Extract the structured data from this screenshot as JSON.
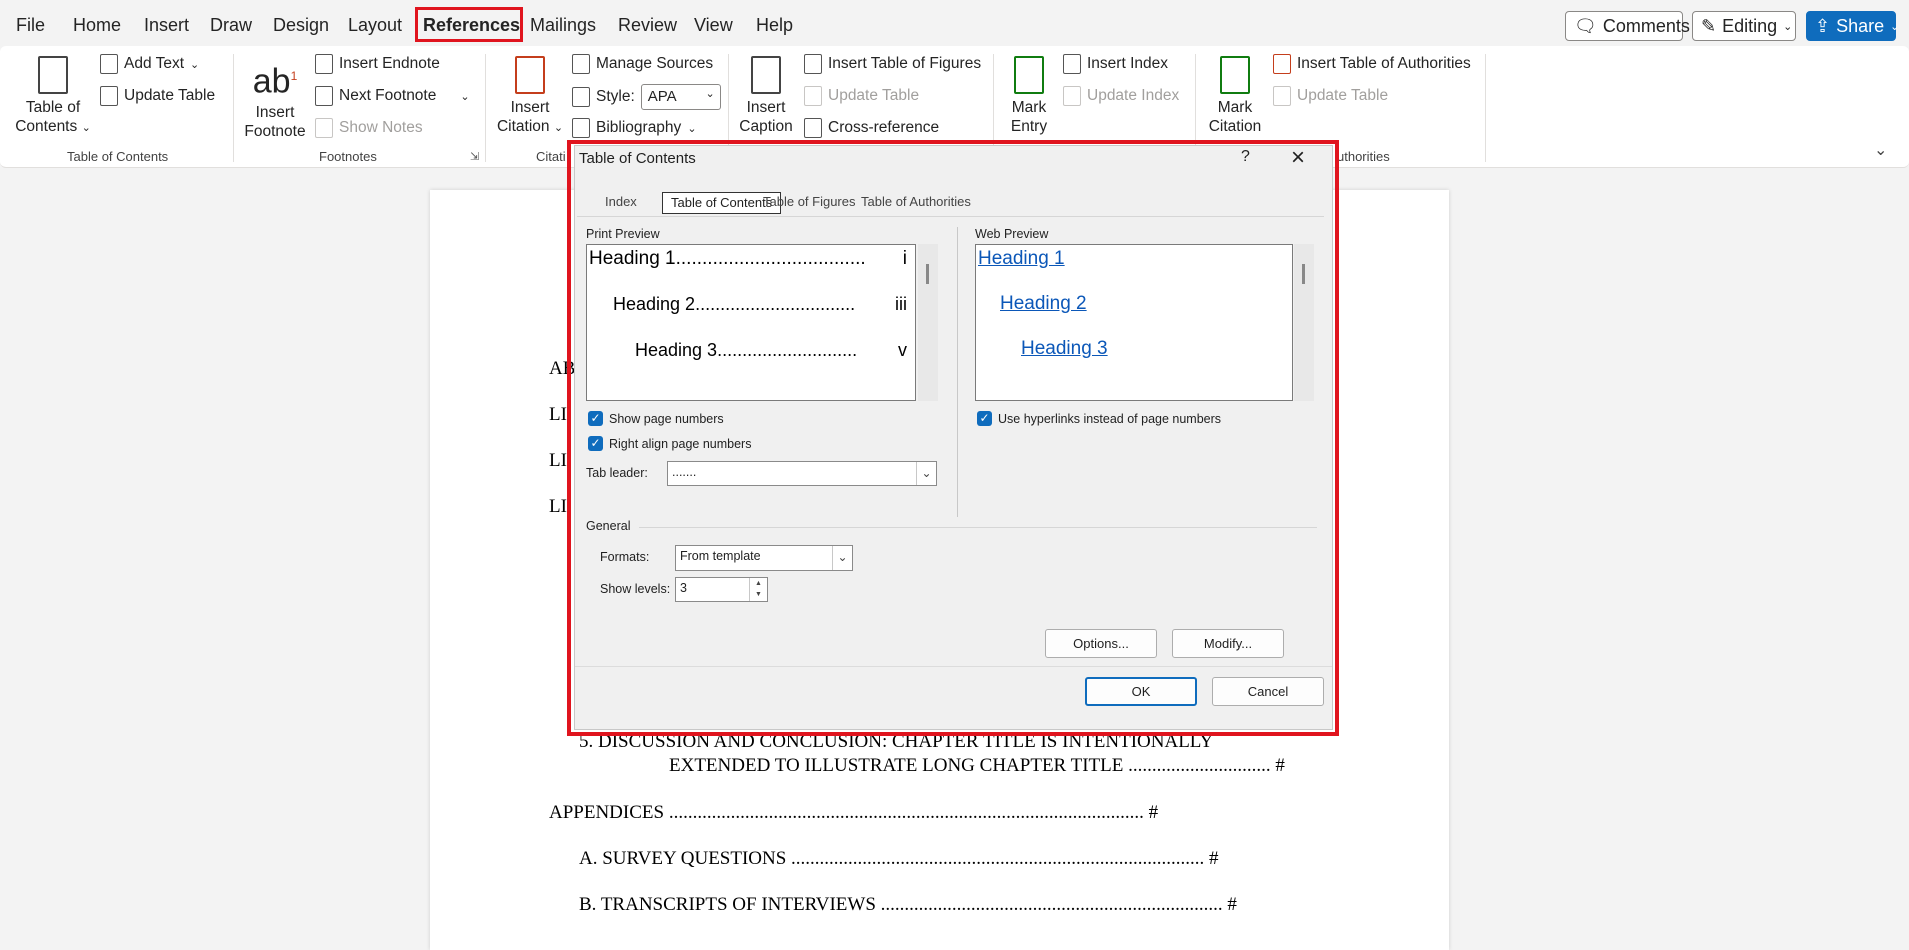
{
  "menu": {
    "tabs": [
      "File",
      "Home",
      "Insert",
      "Draw",
      "Design",
      "Layout",
      "References",
      "Mailings",
      "Review",
      "View",
      "Help"
    ],
    "active_tab": "References"
  },
  "header": {
    "comments": "Comments",
    "editing": "Editing",
    "share": "Share"
  },
  "ribbon": {
    "toc": {
      "big": "Table of Contents",
      "add_text": "Add Text",
      "update_table": "Update Table",
      "group": "Table of Contents"
    },
    "footnotes": {
      "big": "Insert Footnote",
      "insert_endnote": "Insert Endnote",
      "next_footnote": "Next Footnote",
      "show_notes": "Show Notes",
      "group": "Footnotes"
    },
    "citations": {
      "big": "Insert Citation",
      "manage_sources": "Manage Sources",
      "style_label": "Style:",
      "style_value": "APA",
      "bibliography": "Bibliography",
      "group": "Citati"
    },
    "captions": {
      "big": "Insert Caption",
      "insert_tof": "Insert Table of Figures",
      "update_table": "Update Table",
      "cross_reference": "Cross-reference"
    },
    "index": {
      "big": "Mark Entry",
      "insert_index": "Insert Index",
      "update_index": "Update Index"
    },
    "authorities": {
      "big": "Mark Citation",
      "insert_toa": "Insert Table of Authorities",
      "update_table": "Update Table",
      "group": "uthorities"
    }
  },
  "document": {
    "partial_lines": [
      "AB",
      "LI",
      "LI",
      "LI"
    ],
    "chapter5_line1": "5.   DISCUSSION AND CONCLUSION: CHAPTER TITLE IS INTENTIONALLY",
    "chapter5_line2": "EXTENDED TO ILLUSTRATE LONG CHAPTER TITLE ..............................  #",
    "appendices": "APPENDICES ....................................................................................................  #",
    "appendix_a": "A.  SURVEY QUESTIONS .......................................................................................  #",
    "appendix_b": "B.  TRANSCRIPTS OF INTERVIEWS ........................................................................  #"
  },
  "dialog": {
    "title": "Table of Contents",
    "help": "?",
    "tabs": [
      "Index",
      "Table of Contents",
      "Table of Figures",
      "Table of Authorities"
    ],
    "selected_tab": "Table of Contents",
    "print_preview_label": "Print Preview",
    "print_preview": [
      {
        "text": "Heading 1",
        "dots": "....................................",
        "page": "i"
      },
      {
        "text": "Heading 2",
        "dots": "................................",
        "page": "iii"
      },
      {
        "text": "Heading 3",
        "dots": "............................",
        "page": "v"
      }
    ],
    "web_preview_label": "Web Preview",
    "web_preview": [
      "Heading 1",
      "Heading 2",
      "Heading 3"
    ],
    "show_page_numbers": {
      "label": "Show page numbers",
      "checked": true
    },
    "right_align": {
      "label": "Right align page numbers",
      "checked": true
    },
    "use_hyperlinks": {
      "label": "Use hyperlinks instead of page numbers",
      "checked": true
    },
    "tab_leader": {
      "label": "Tab leader:",
      "value": "......."
    },
    "general_label": "General",
    "formats": {
      "label": "Formats:",
      "value": "From template"
    },
    "show_levels": {
      "label": "Show levels:",
      "value": "3"
    },
    "options_button": "Options...",
    "modify_button": "Modify...",
    "ok_button": "OK",
    "cancel_button": "Cancel"
  },
  "colors": {
    "highlight_red": "#e0141e",
    "accent_blue": "#0f6cbd",
    "link_blue": "#0b57b8"
  }
}
